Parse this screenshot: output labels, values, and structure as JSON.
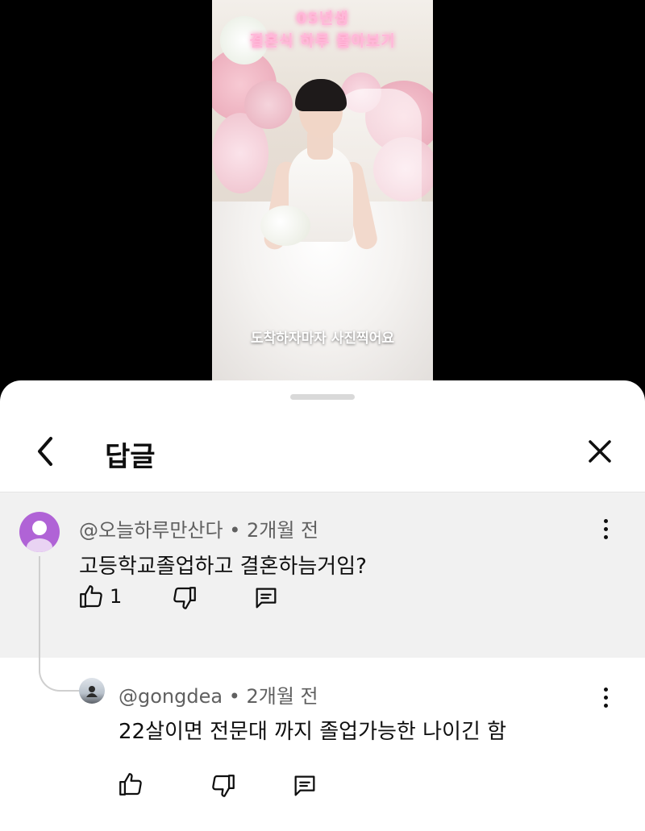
{
  "video": {
    "title_line1": "05년생",
    "title_line2": "결혼식 하루 몰아보기",
    "caption": "도착하자마자 사진찍어요"
  },
  "sheet": {
    "title": "답글",
    "back_icon": "chevron-left-icon",
    "close_icon": "close-icon"
  },
  "parent_comment": {
    "author": "@오늘하루만산다",
    "time": "• 2개월 전",
    "text": "고등학교졸업하고 결혼하늠거임?",
    "like_count": "1",
    "avatar_color": "#b063d6"
  },
  "reply": {
    "author": "@gongdea",
    "time": "• 2개월 전",
    "text": "22살이면 전문대 까지 졸업가능한 나이긴 함"
  }
}
